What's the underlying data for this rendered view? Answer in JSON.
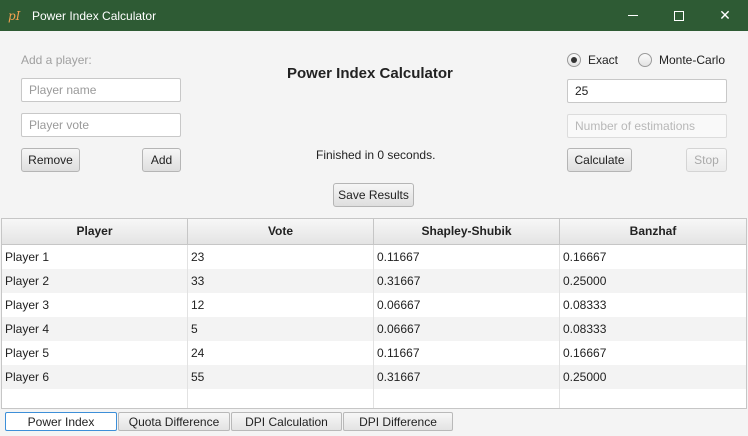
{
  "window": {
    "icon_text": "pI",
    "title": "Power Index Calculator"
  },
  "left_panel": {
    "add_player_label": "Add a player:",
    "player_name_placeholder": "Player name",
    "player_vote_placeholder": "Player vote",
    "remove_label": "Remove",
    "add_label": "Add"
  },
  "center": {
    "heading": "Power Index Calculator",
    "status": "Finished in 0 seconds.",
    "save_label": "Save Results"
  },
  "right_panel": {
    "mode_exact": "Exact",
    "mode_monte_carlo": "Monte-Carlo",
    "selected_mode": "Exact",
    "quota_value": "25",
    "estimations_placeholder": "Number of estimations",
    "calculate_label": "Calculate",
    "stop_label": "Stop"
  },
  "table": {
    "columns": [
      "Player",
      "Vote",
      "Shapley-Shubik",
      "Banzhaf"
    ],
    "rows": [
      [
        "Player 1",
        "23",
        "0.11667",
        "0.16667"
      ],
      [
        "Player 2",
        "33",
        "0.31667",
        "0.25000"
      ],
      [
        "Player 3",
        "12",
        "0.06667",
        "0.08333"
      ],
      [
        "Player 4",
        "5",
        "0.06667",
        "0.08333"
      ],
      [
        "Player 5",
        "24",
        "0.11667",
        "0.16667"
      ],
      [
        "Player 6",
        "55",
        "0.31667",
        "0.25000"
      ],
      [
        "",
        "",
        "",
        ""
      ]
    ]
  },
  "tabs": [
    {
      "label": "Power Index",
      "active": true
    },
    {
      "label": "Quota Difference",
      "active": false
    },
    {
      "label": "DPI Calculation",
      "active": false
    },
    {
      "label": "DPI Difference",
      "active": false
    }
  ]
}
